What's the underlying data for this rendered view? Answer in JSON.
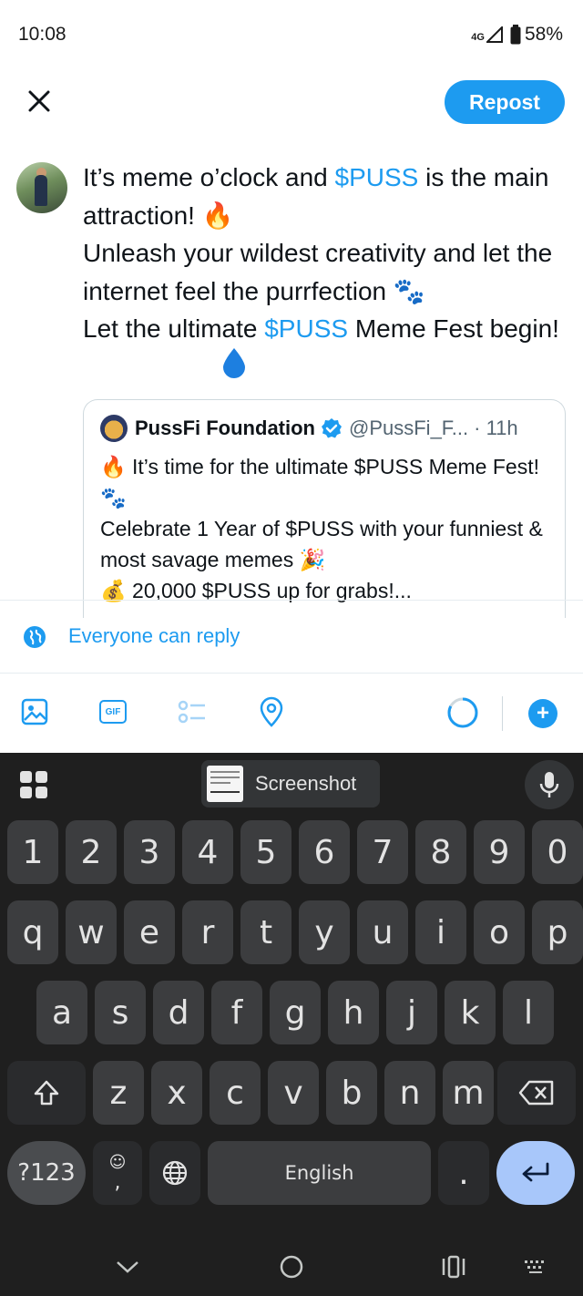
{
  "status_bar": {
    "time": "10:08",
    "network": "4G",
    "battery": "58%"
  },
  "header": {
    "repost_label": "Repost"
  },
  "compose": {
    "line1_pre": "It’s meme o’clock and ",
    "tag1": "$PUSS",
    "line1_post": " is the main attraction! 🔥",
    "line2": "Unleash your wildest creativity and let the internet feel the purrfection 🐾",
    "line3_pre": "Let the ultimate ",
    "tag2": "$PUSS",
    "line3_post": " Meme Fest begin!"
  },
  "quote": {
    "name": "PussFi Foundation",
    "handle": "@PussFi_F...",
    "time": "· 11h",
    "line1": "🔥 It’s time for the ultimate $PUSS Meme Fest! 🐾",
    "line2": "Celebrate 1 Year of $PUSS with your funniest & most savage memes 🎉",
    "line3": "💰 20,000 $PUSS up for grabs!..."
  },
  "reply_setting": {
    "label": "Everyone can reply"
  },
  "colors": {
    "accent": "#1d9bf0",
    "keyboard_bg": "#1f1f1f",
    "key_bg": "#3c3d3f",
    "enter_key": "#a8c7fa"
  },
  "keyboard": {
    "clipboard_label": "Screenshot",
    "row_numbers": [
      "1",
      "2",
      "3",
      "4",
      "5",
      "6",
      "7",
      "8",
      "9",
      "0"
    ],
    "row_q": [
      "q",
      "w",
      "e",
      "r",
      "t",
      "y",
      "u",
      "i",
      "o",
      "p"
    ],
    "row_a": [
      "a",
      "s",
      "d",
      "f",
      "g",
      "h",
      "j",
      "k",
      "l"
    ],
    "row_z": [
      "z",
      "x",
      "c",
      "v",
      "b",
      "n",
      "m"
    ],
    "symbols_label": "?123",
    "comma": ",",
    "space_label": "English",
    "period": "."
  }
}
